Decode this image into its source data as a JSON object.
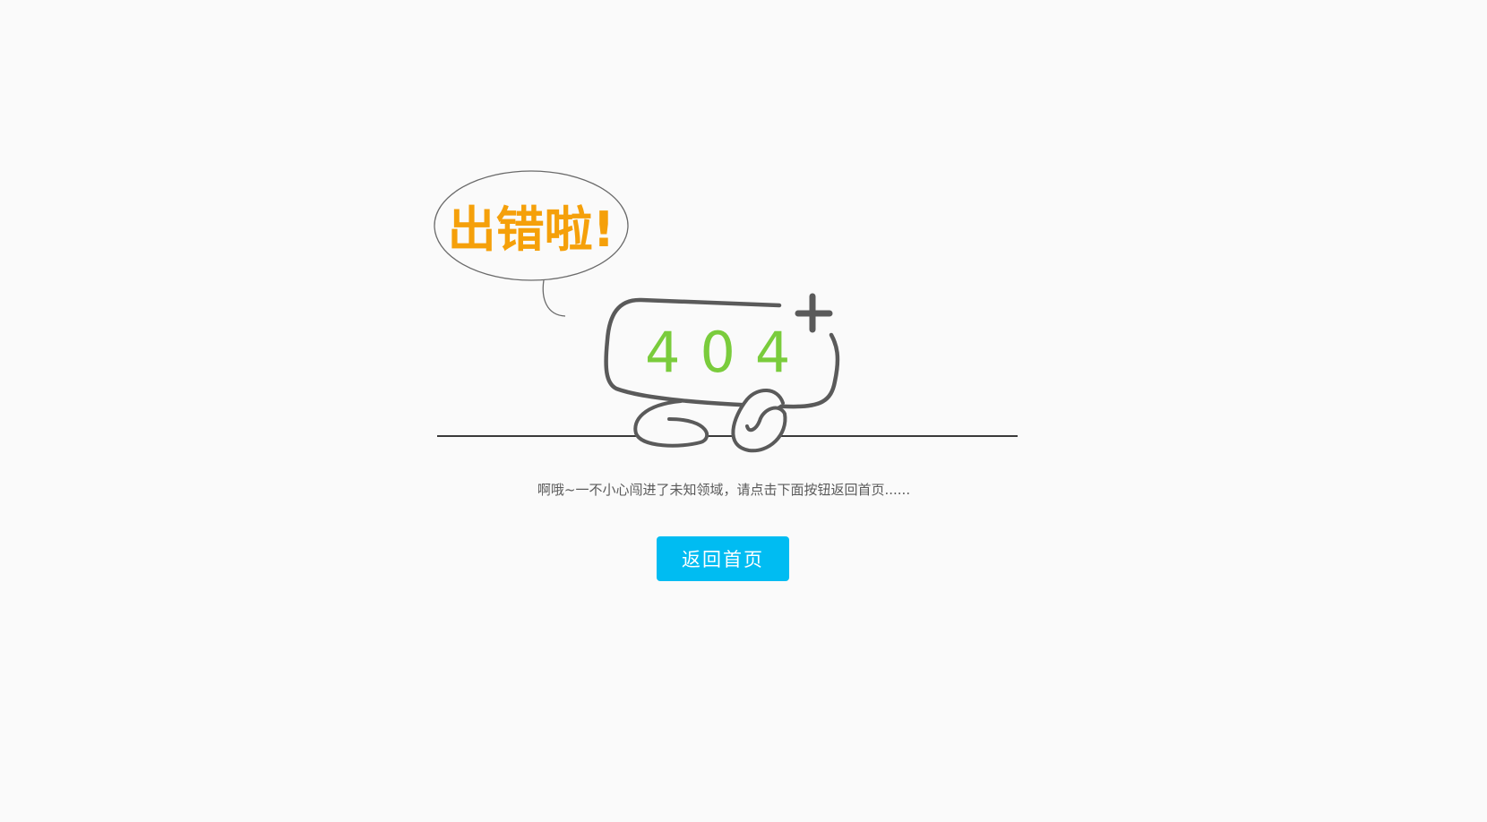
{
  "bubble": {
    "text": "出错啦!"
  },
  "sign": {
    "code": "404",
    "plus_glyph": "plus-icon"
  },
  "message": {
    "text": "啊哦~一不小心闯进了未知领域，请点击下面按钮返回首页......"
  },
  "button": {
    "label": "返回首页"
  },
  "colors": {
    "background": "#fafafa",
    "bubble_text": "#f5a00a",
    "sign_text": "#7acc3c",
    "outline": "#5a5a5a",
    "button": "#00bcf2",
    "button_text": "#ffffff"
  }
}
